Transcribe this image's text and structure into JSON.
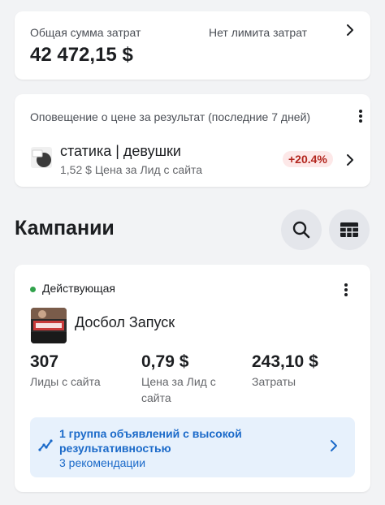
{
  "spend_card": {
    "label": "Общая сумма затрат",
    "limit_text": "Нет лимита затрат",
    "value": "42 472,15 $"
  },
  "alert_card": {
    "title": "Оповещение о цене за результат (последние 7 дней)",
    "ad_name": "статика | девушки",
    "ad_metric": "1,52 $  Цена за Лид с сайта",
    "badge": "+20.4%",
    "badge_color": "#b3261e"
  },
  "campaigns": {
    "title": "Кампании",
    "icons": [
      "search-icon",
      "table-icon"
    ]
  },
  "campaign_card": {
    "status": "Действующая",
    "status_color": "#31a24c",
    "name": "Досбол Запуск",
    "stats": [
      {
        "value": "307",
        "label": "Лиды с сайта"
      },
      {
        "value": "0,79 $",
        "label": "Цена за Лид с сайта"
      },
      {
        "value": "243,10 $",
        "label": "Затраты"
      }
    ],
    "recommendation": {
      "title": "1 группа объявлений с высокой результативностью",
      "subtitle": "3 рекомендации",
      "color": "#1b6ac9"
    }
  }
}
